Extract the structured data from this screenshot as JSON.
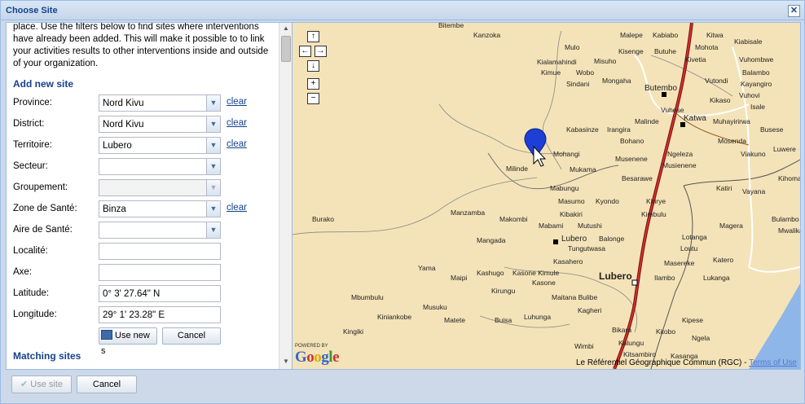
{
  "dialog": {
    "title": "Choose Site"
  },
  "intro_text": "place. Use the filters below to find sites where interventions have already been added. This will make it possible to to link your activities results to other interventions inside and outside of your organization.",
  "add_section": {
    "title": "Add new site"
  },
  "fields": {
    "province": {
      "label": "Province:",
      "value": "Nord Kivu",
      "clear": "clear"
    },
    "district": {
      "label": "District:",
      "value": "Nord Kivu",
      "clear": "clear"
    },
    "territoire": {
      "label": "Territoire:",
      "value": "Lubero",
      "clear": "clear"
    },
    "secteur": {
      "label": "Secteur:",
      "value": ""
    },
    "groupement": {
      "label": "Groupement:",
      "value": ""
    },
    "zone": {
      "label": "Zone de Santé:",
      "value": "Binza",
      "clear": "clear"
    },
    "aire": {
      "label": "Aire de Santé:",
      "value": ""
    },
    "localite": {
      "label": "Localité:",
      "value": ""
    },
    "axe": {
      "label": "Axe:",
      "value": ""
    },
    "latitude": {
      "label": "Latitude:",
      "value": "0° 3' 27.64\" N"
    },
    "longitude": {
      "label": "Longitude:",
      "value": "29° 1' 23.28\" E"
    }
  },
  "form_buttons": {
    "use_new": "Use new s",
    "cancel": "Cancel"
  },
  "matching_section": {
    "title": "Matching sites"
  },
  "map": {
    "labels": {
      "bitembe": "Bitembe",
      "kanzoka": "Kanzoka",
      "malepe": "Malepe",
      "kabiabo": "Kabiabo",
      "kitwa": "Kitwa",
      "kiabisale": "Kiabisale",
      "mohota": "Mohota",
      "mulo": "Mulo",
      "kisenge": "Kisenge",
      "butuhe": "Butuhe",
      "kivetia": "Kivetia",
      "vuhombwe": "Vuhombwe",
      "kialamahindi": "Kialamahindi",
      "misuho": "Misuho",
      "balambo": "Balambo",
      "kimue": "Kimue",
      "wobo": "Wobo",
      "sindani": "Sindani",
      "mongaha": "Mongaha",
      "butembo": "Butembo",
      "vutondi": "Vutondi",
      "kayangiro": "Kayangiro",
      "vuhovi": "Vuhovi",
      "kikaso": "Kikaso",
      "isale": "Isale",
      "vuhese": "Vuhese",
      "malinde": "Malinde",
      "katwa": "Katwa",
      "muhayirirwa": "Muhayirirwa",
      "busese": "Busese",
      "kabasinze": "Kabasinze",
      "irangira": "Irangira",
      "bohano": "Bohano",
      "mohangi": "Mohangi",
      "mosenda": "Mosenda",
      "viakuno": "Viakuno",
      "luwere": "Luwere",
      "musenene": "Musenene",
      "ngeleza": "Ngeleza",
      "milinde": "Milinde",
      "mukama": "Mukama",
      "musienene": "Musienene",
      "kihoma": "Kihoma",
      "besarawe": "Besarawe",
      "mabungu": "Mabungu",
      "katiri": "Katiri",
      "vayana": "Vayana",
      "masumo": "Masumo",
      "kyondo": "Kyondo",
      "kirirye": "Kirirye",
      "manzamba": "Manzamba",
      "kibakiri": "Kibakiri",
      "kimbulu": "Kimbulu",
      "magera": "Magera",
      "bulambo": "Bulambo",
      "burako": "Burako",
      "makombi": "Makombi",
      "mabami": "Mabami",
      "mutushi": "Mutushi",
      "mwalika": "Mwalika",
      "mangada": "Mangada",
      "lubero_small": "Lubero",
      "balonge": "Balonge",
      "lotanga": "Lotanga",
      "lutongu": "Tungutwasa",
      "loutu": "Loutu",
      "kasahero": "Kasahero",
      "masereke": "Masereke",
      "katero": "Katero",
      "yama": "Yama",
      "kashugo": "Kashugo",
      "kasonekimule": "Kasone Kimule",
      "lubero": "Lubero",
      "ilambo": "Ilambo",
      "lukanga": "Lukanga",
      "maipi": "Maipi",
      "kasone": "Kasone",
      "kirungu": "Kirungu",
      "maitana": "Maitana Bulibe",
      "mbumbulu": "Mbumbulu",
      "musuku": "Musuku",
      "kagheri": "Kagheri",
      "kiniankobe": "Kiniankobe",
      "matete": "Matete",
      "buisa": "Buisa",
      "luhunga": "Luhunga",
      "kipese": "Kipese",
      "kingiki": "Kingiki",
      "bikara": "Bikara",
      "kitobo": "Kitobo",
      "kalungu": "Kalungu",
      "wimbi": "Wimbi",
      "kitsambiro": "Kitsambiro",
      "kasanga": "Kasanga",
      "ngela": "Ngela"
    },
    "powered_by": "POWERED BY",
    "google": "Google",
    "attribution": "Le Référentiel Géographique Commun (RGC) -",
    "terms": "Terms of Use",
    "marker_color": "#1e3fd6",
    "road_color": "#b22222",
    "water_color": "#8fb6e8"
  },
  "footer": {
    "use_site": "Use site",
    "cancel": "Cancel"
  }
}
